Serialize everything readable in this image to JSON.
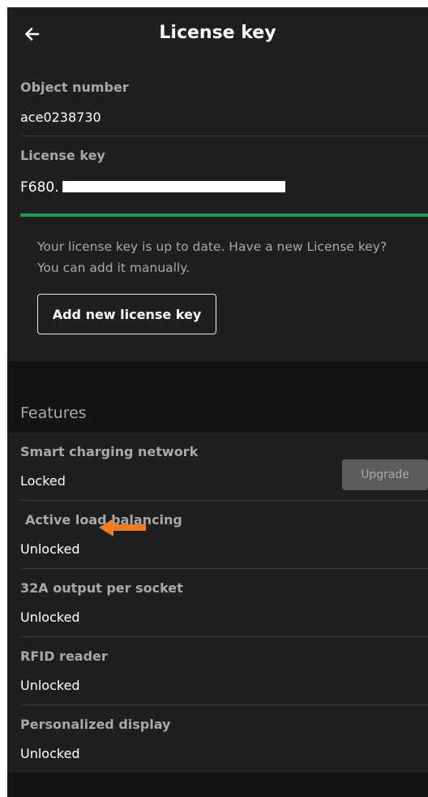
{
  "header": {
    "title": "License key",
    "back_icon": "arrow-left-icon"
  },
  "object_number": {
    "label": "Object number",
    "value": "ace0238730"
  },
  "license_key": {
    "label": "License key",
    "value_visible_prefix": "F680."
  },
  "status_color": "#1aa05a",
  "info": {
    "text": "Your license key is up to date. Have a new License key? You can add it manually."
  },
  "add_button": {
    "label": "Add new license key"
  },
  "features": {
    "title": "Features",
    "upgrade_label": "Upgrade",
    "items": [
      {
        "name": "Smart charging network",
        "status": "Locked"
      },
      {
        "name": "Active load balancing",
        "status": "Unlocked"
      },
      {
        "name": "32A output per socket",
        "status": "Unlocked"
      },
      {
        "name": "RFID reader",
        "status": "Unlocked"
      },
      {
        "name": "Personalized display",
        "status": "Unlocked"
      }
    ]
  },
  "annotation": {
    "icon": "orange-pointer-arrow-icon",
    "color": "#f07d22"
  }
}
